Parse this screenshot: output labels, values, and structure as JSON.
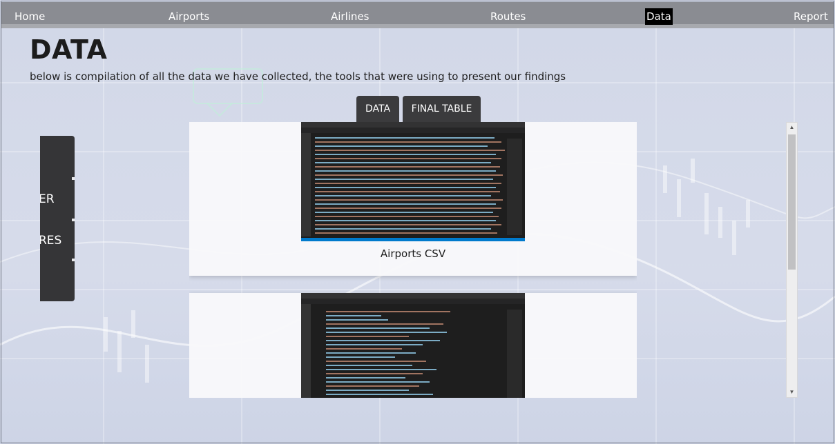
{
  "nav": {
    "items": [
      {
        "label": "Home"
      },
      {
        "label": "Airports"
      },
      {
        "label": "Airlines"
      },
      {
        "label": "Routes"
      },
      {
        "label": "Data"
      },
      {
        "label": "Report"
      }
    ],
    "active": "Data"
  },
  "page": {
    "title": "DATA",
    "subtitle": "below is compilation of all the data we have collected, the tools that were using to present our findings"
  },
  "tabs": [
    {
      "label": "DATA"
    },
    {
      "label": "FINAL TABLE"
    }
  ],
  "side_panel": {
    "labels": [
      "ER",
      "RES"
    ]
  },
  "cards": [
    {
      "caption": "Airports CSV"
    },
    {
      "caption": ""
    }
  ],
  "colors": {
    "navbar": "#8a8c92",
    "active_nav": "#000000",
    "tab_bg": "#3b3b3d",
    "panel_bg": "#353537"
  },
  "icons": {
    "scroll_up": "▲",
    "scroll_down": "▼"
  }
}
